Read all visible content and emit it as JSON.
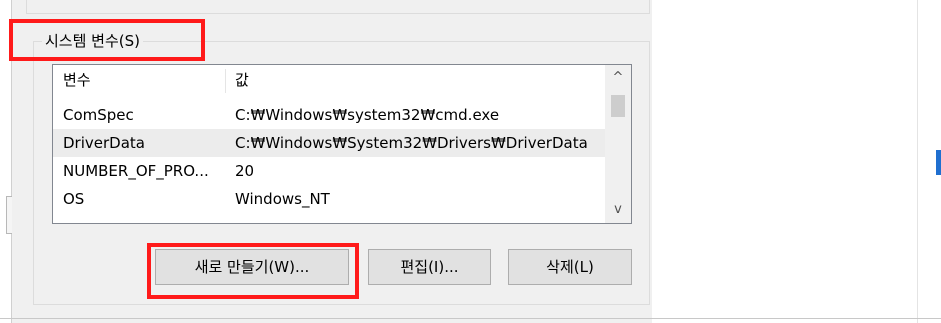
{
  "system_variables": {
    "group_title": "시스템 변수(S)",
    "columns": {
      "name": "변수",
      "value": "값"
    },
    "rows": [
      {
        "name": "ComSpec",
        "value": "C:₩Windows₩system32₩cmd.exe",
        "selected": false
      },
      {
        "name": "DriverData",
        "value": "C:₩Windows₩System32₩Drivers₩DriverData",
        "selected": true
      },
      {
        "name": "NUMBER_OF_PRO...",
        "value": "20",
        "selected": false
      },
      {
        "name": "OS",
        "value": "Windows_NT",
        "selected": false
      }
    ],
    "scroll": {
      "up": "^",
      "down": "v"
    }
  },
  "buttons": {
    "new": "새로 만들기(W)...",
    "edit": "편집(I)...",
    "delete": "삭제(L)"
  },
  "colors": {
    "annotation": "#ff1a1a",
    "accent": "#1f6fd0",
    "selected_row": "#ececec"
  }
}
